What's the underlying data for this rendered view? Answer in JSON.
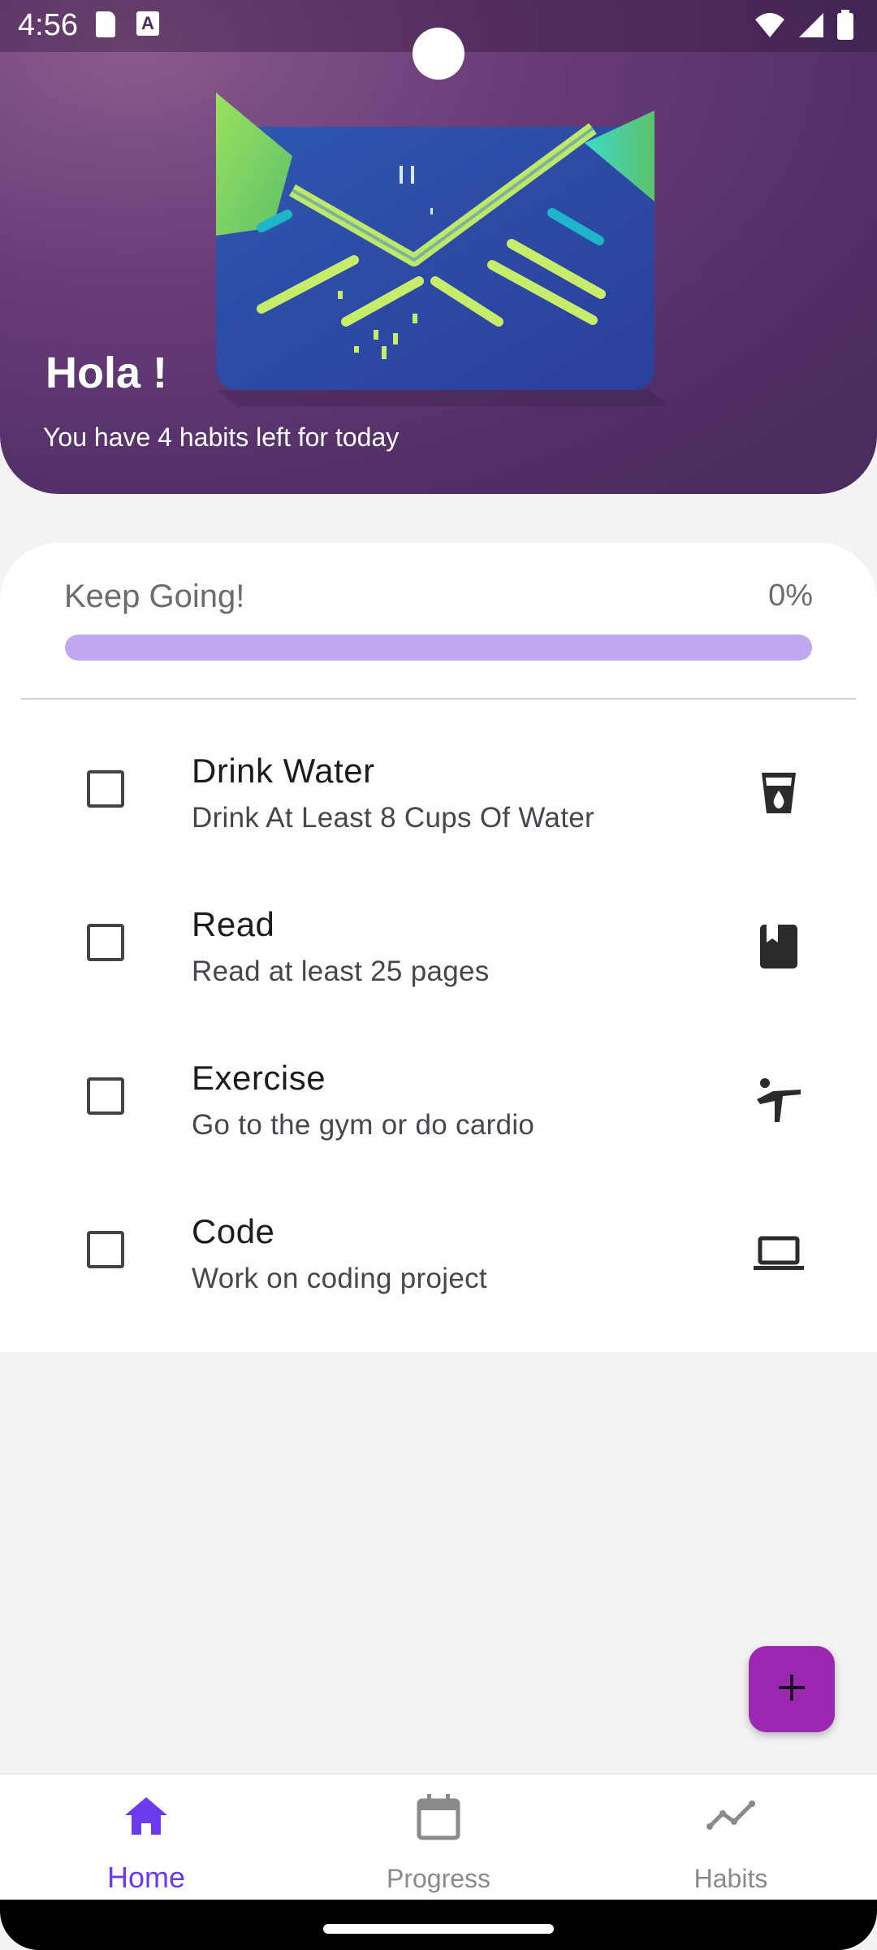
{
  "status_bar": {
    "time": "4:56",
    "left_icons": [
      "sd-card-icon",
      "a-icon"
    ],
    "a_icon_letter": "A",
    "right_icons": [
      "wifi-icon",
      "signal-icon",
      "battery-icon"
    ]
  },
  "header": {
    "greeting": "Hola !",
    "habits_left": "You have 4 habits left for today",
    "illustration": "envelope-illustration"
  },
  "progress": {
    "label": "Keep Going!",
    "percent_text": "0%",
    "value": 0,
    "track_color": "#c2a8f0"
  },
  "habits": [
    {
      "title": "Drink Water",
      "description": "Drink At Least 8 Cups Of Water",
      "icon": "water-glass-icon",
      "checked": false
    },
    {
      "title": "Read",
      "description": "Read at least 25 pages",
      "icon": "book-icon",
      "checked": false
    },
    {
      "title": "Exercise",
      "description": "Go to the gym or do cardio",
      "icon": "exercise-icon",
      "checked": false
    },
    {
      "title": "Code",
      "description": "Work on coding project",
      "icon": "laptop-icon",
      "checked": false
    }
  ],
  "fab": {
    "icon": "plus-icon",
    "color": "#9c27b0"
  },
  "bottom_nav": {
    "items": [
      {
        "label": "Home",
        "icon": "home-icon",
        "active": true
      },
      {
        "label": "Progress",
        "icon": "calendar-icon",
        "active": false
      },
      {
        "label": "Habits",
        "icon": "trend-icon",
        "active": false
      }
    ],
    "active_color": "#6c3aed"
  }
}
